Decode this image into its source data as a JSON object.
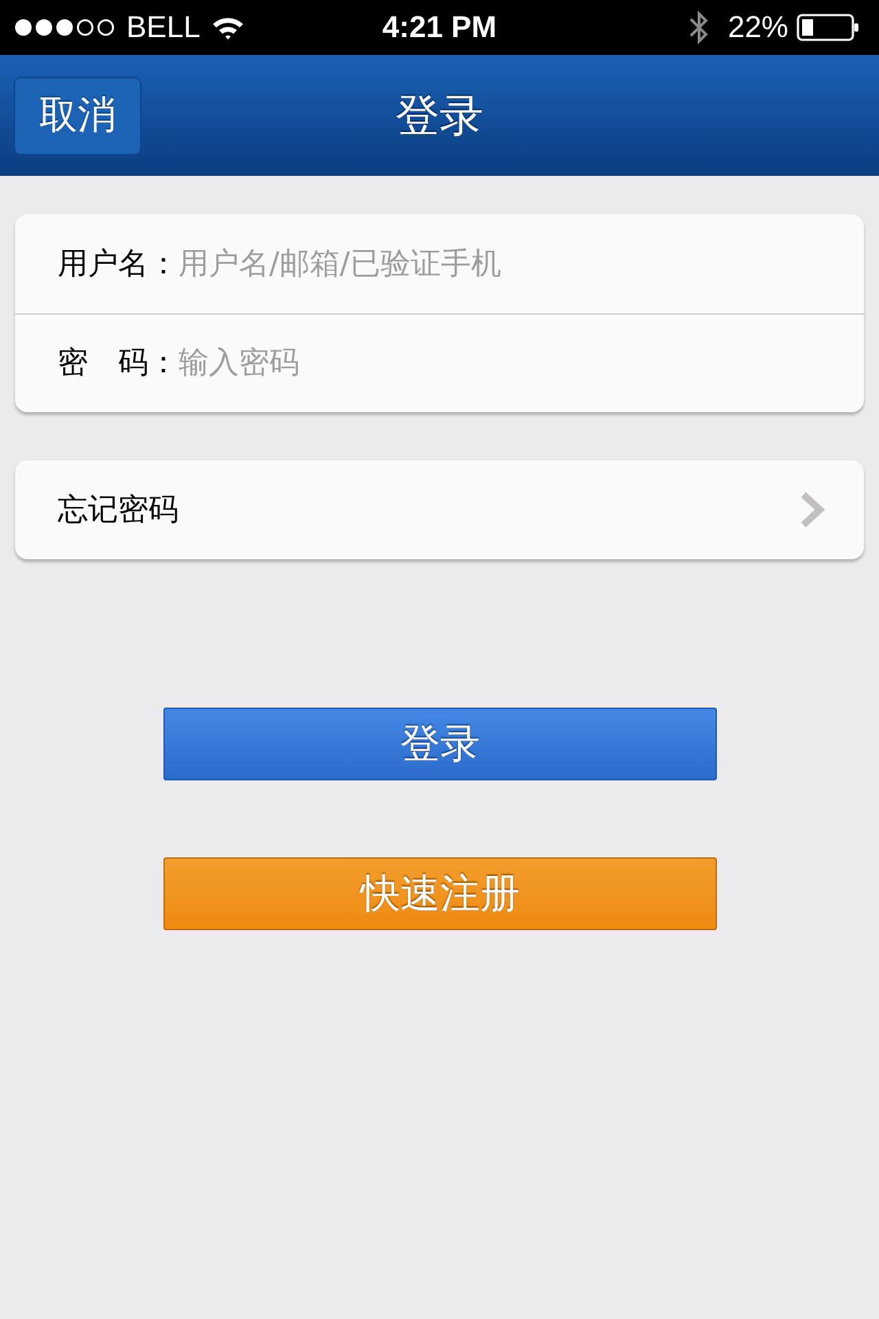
{
  "status_bar": {
    "carrier": "BELL",
    "time": "4:21 PM",
    "battery": "22%"
  },
  "nav_bar": {
    "cancel": "取消",
    "title": "登录"
  },
  "form": {
    "fields": [
      {
        "label": "用户名：",
        "placeholder": "用户名/邮箱/已验证手机"
      },
      {
        "label": "密　码：",
        "placeholder": "输入密码"
      }
    ]
  },
  "links": [
    {
      "label": "忘记密码"
    }
  ],
  "buttons": [
    {
      "label": "登录",
      "kind": "primary"
    },
    {
      "label": "快速注册",
      "kind": "secondary"
    }
  ]
}
